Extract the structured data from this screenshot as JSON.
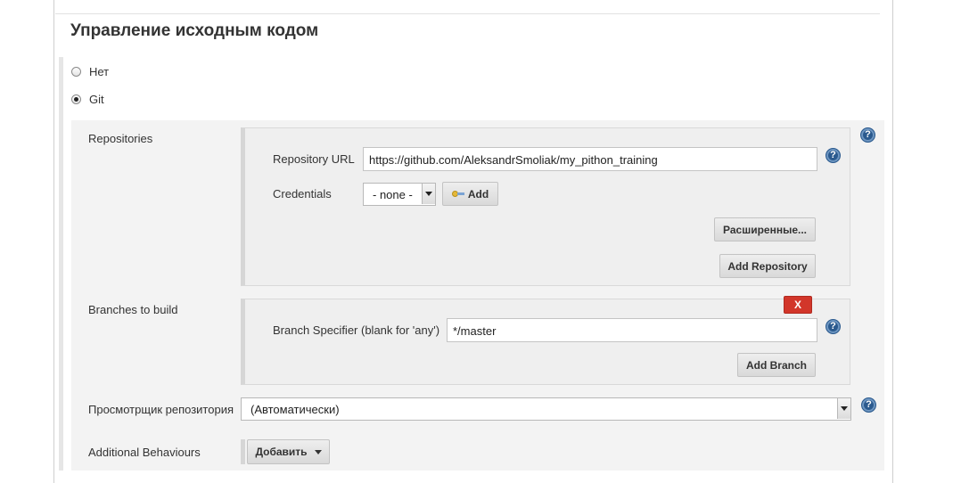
{
  "section": {
    "title": "Управление исходным кодом"
  },
  "scm_options": [
    {
      "label": "Нет",
      "selected": false
    },
    {
      "label": "Git",
      "selected": true
    }
  ],
  "repositories": {
    "label": "Repositories",
    "url_label": "Repository URL",
    "url_value": "https://github.com/AleksandrSmoliak/my_pithon_training",
    "credentials_label": "Credentials",
    "credentials_value": "- none -",
    "add_label": "Add",
    "advanced_label": "Расширенные...",
    "add_repository_label": "Add Repository"
  },
  "branches": {
    "label": "Branches to build",
    "delete_label": "X",
    "specifier_label": "Branch Specifier (blank for 'any')",
    "specifier_value": "*/master",
    "add_branch_label": "Add Branch"
  },
  "browser": {
    "label": "Просмотрщик репозитория",
    "value": "(Автоматически)"
  },
  "behaviours": {
    "label": "Additional Behaviours",
    "add_label": "Добавить"
  },
  "help_icon_glyph": "?",
  "colors": {
    "help_icon": "#2b5a8e",
    "delete_button": "#d2362a",
    "panel_bg": "#f3f3f3"
  }
}
